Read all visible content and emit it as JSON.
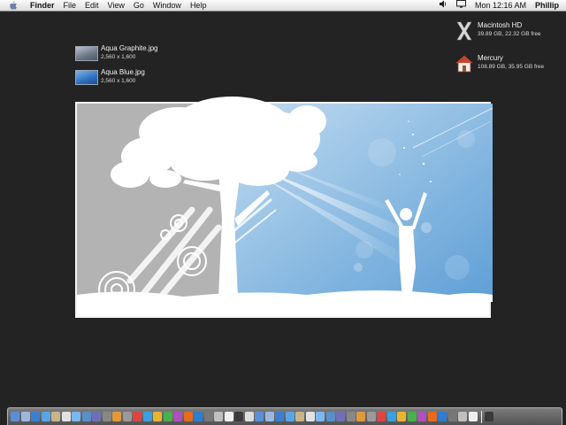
{
  "menubar": {
    "app": "Finder",
    "items": [
      "File",
      "Edit",
      "View",
      "Go",
      "Window",
      "Help"
    ],
    "clock": "Mon 12:16 AM",
    "user": "Phillip"
  },
  "desktop": {
    "files": [
      {
        "name": "Aqua Graphite.jpg",
        "size": "2,560 x 1,600"
      },
      {
        "name": "Aqua Blue.jpg",
        "size": "2,560 x 1,600"
      }
    ],
    "disks": [
      {
        "name": "Macintosh HD",
        "info": "39.89 GB, 22.32 GB free"
      },
      {
        "name": "Mercury",
        "info": "108.89 GB, 35.95 GB free"
      }
    ]
  },
  "colors": {
    "desktop": "#232323",
    "sky": "#8fbde3",
    "graphite": "#b3b3b3"
  },
  "dock": {
    "icons": [
      "finder-icon",
      "mail-icon",
      "safari-icon",
      "ichat-icon",
      "address-book-icon",
      "ical-icon",
      "itunes-icon",
      "iphoto-icon",
      "imovie-icon",
      "idvd-icon",
      "garageband-icon",
      "system-prefs-icon",
      "app-icon",
      "app-icon",
      "app-icon",
      "app-icon",
      "app-icon",
      "app-icon",
      "app-icon",
      "app-icon",
      "app-icon",
      "app-icon",
      "app-icon",
      "app-icon",
      "app-icon",
      "app-icon",
      "app-icon",
      "app-icon",
      "app-icon",
      "app-icon",
      "app-icon",
      "app-icon",
      "app-icon",
      "app-icon",
      "app-icon",
      "app-icon",
      "app-icon",
      "app-icon",
      "app-icon",
      "app-icon",
      "app-icon",
      "app-icon",
      "app-icon",
      "app-icon",
      "app-icon",
      "app-icon",
      "trash-icon"
    ]
  }
}
